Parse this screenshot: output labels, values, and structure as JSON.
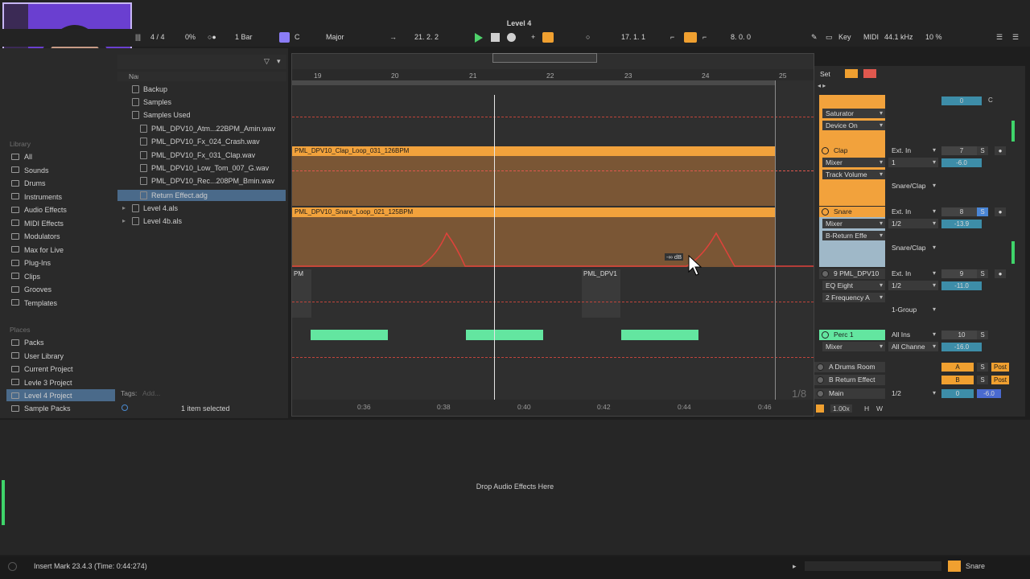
{
  "window": {
    "title": "Level 4"
  },
  "transport": {
    "signature": "4 / 4",
    "groove": "0%",
    "quantize": "1 Bar",
    "key_root": "C",
    "scale": "Major",
    "position": "21.   2.   2",
    "loop_start": "17.   1.   1",
    "loop_length": "8.   0.   0",
    "key_label": "Key",
    "midi_label": "MIDI",
    "sample_rate": "44.1 kHz",
    "cpu": "10 %"
  },
  "browser": {
    "name_col_label": "Name",
    "folders": [
      "Backup",
      "Samples",
      "Samples Used"
    ],
    "files": [
      "PML_DPV10_Atm...22BPM_Amin.wav",
      "PML_DPV10_Fx_024_Crash.wav",
      "PML_DPV10_Fx_031_Clap.wav",
      "PML_DPV10_Low_Tom_007_G.wav",
      "PML_DPV10_Rec...208PM_Bmin.wav",
      "Return Effect.adg",
      "Level 4.als",
      "Level 4b.als"
    ],
    "library_title": "Library",
    "library": [
      "All",
      "Sounds",
      "Drums",
      "Instruments",
      "Audio Effects",
      "MIDI Effects",
      "Modulators",
      "Max for Live",
      "Plug-Ins",
      "Clips",
      "Grooves",
      "Templates"
    ],
    "places_title": "Places",
    "places": [
      "Packs",
      "User Library",
      "Current Project",
      "Levle 3 Project",
      "Level 4 Project",
      "Sample Packs"
    ],
    "tags_label": "Tags:",
    "tags_add": "Add...",
    "selection_status": "1 item selected"
  },
  "arrangement": {
    "bars": [
      "19",
      "20",
      "21",
      "22",
      "23",
      "24",
      "25"
    ],
    "times": [
      "0:36",
      "0:38",
      "0:40",
      "0:42",
      "0:44",
      "0:46"
    ],
    "clap_clip": "PML_DPV10_Clap_Loop_031_126BPM",
    "snare_clip": "PML_DPV10_Snare_Loop_021_125BPM",
    "snare_clip_short": "PML_DPV10_Sna",
    "perc_clip": "PML_DPV1",
    "perc_clip_left": "PM",
    "db_tooltip": "-∞ dB",
    "grid_label": "1/8"
  },
  "mixer": {
    "set_label": "Set",
    "tracks": [
      {
        "name": "Clap",
        "input": "Ext. In",
        "chooser": "Mixer",
        "param": "Track Volume",
        "vol": "7",
        "group": "Snare/Clap"
      },
      {
        "name": "Snare",
        "input": "Ext. In",
        "chooser": "Mixer",
        "param": "B-Return Effe",
        "vol": "8",
        "group": "Snare/Clap",
        "vol2": "-13.9"
      },
      {
        "name": "9 PML_DPV10",
        "input": "Ext. In",
        "chooser": "EQ Eight",
        "param": "2 Frequency A",
        "vol": "9",
        "sub_input": "1/2",
        "vol2": "-11.0",
        "group": "1-Group"
      },
      {
        "name": "Perc 1",
        "input": "All Ins",
        "chooser": "Mixer",
        "vol": "10",
        "sub_input": "All Channe",
        "vol2": "-16.0"
      }
    ],
    "top_devices": [
      "Saturator",
      "Device On"
    ],
    "returns": [
      {
        "name": "A Drums Room",
        "letter": "A",
        "post": "Post"
      },
      {
        "name": "B Return Effect",
        "letter": "B",
        "post": "Post"
      }
    ],
    "main": {
      "name": "Main",
      "input": "1/2",
      "vol": "0",
      "vol2": "-6.0"
    },
    "tempo_scale": "1.00x",
    "h_label": "H",
    "w_label": "W",
    "snare_sub_input": "1/2",
    "clap_sub_input": "1",
    "clap_vol2": "-6.0",
    "top_vol": "0",
    "pan": "C"
  },
  "device_view": {
    "drop_hint": "Drop Audio Effects Here"
  },
  "status": {
    "message": "Insert Mark 23.4.3 (Time: 0:44:274)",
    "selected_track": "Snare"
  }
}
